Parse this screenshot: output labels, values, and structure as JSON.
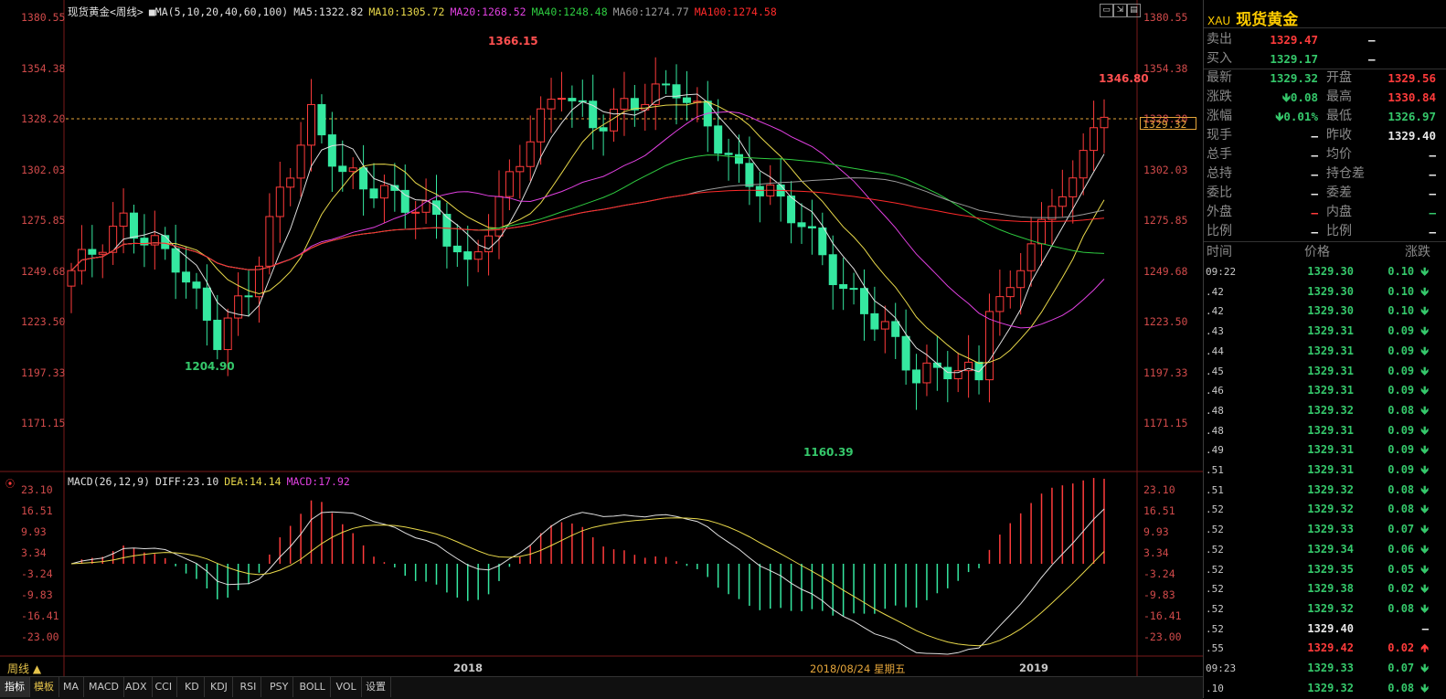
{
  "chart_title": "现货黄金<周线>",
  "ma_legend": {
    "params": "MA(5,10,20,40,60,100)",
    "ma5": "MA5:1322.82",
    "ma10": "MA10:1305.72",
    "ma20": "MA20:1268.52",
    "ma40": "MA40:1248.48",
    "ma60": "MA60:1274.77",
    "ma100": "MA100:1274.58"
  },
  "macd_legend": {
    "params": "MACD(26,12,9)",
    "diff": "DIFF:23.10",
    "dea": "DEA:14.14",
    "macd": "MACD:17.92"
  },
  "colors": {
    "up": "#ff3b3b",
    "down": "#35e8a0",
    "ma5": "#e0e0e0",
    "ma10": "#e8d84a",
    "ma20": "#e040e0",
    "ma40": "#2ecc40",
    "ma60": "#9a9a9a",
    "ma100": "#ff2a2a",
    "price_line": "#e4a53a"
  },
  "price_axis_left": [
    "1380.55",
    "1354.38",
    "1328.20",
    "1302.03",
    "1275.85",
    "1249.68",
    "1223.50",
    "1197.33",
    "1171.15"
  ],
  "price_axis_right": [
    "1380.55",
    "1354.38",
    "1328.20",
    "1302.03",
    "1275.85",
    "1249.68",
    "1223.50",
    "1197.33",
    "1171.15"
  ],
  "macd_axis": [
    "23.10",
    "16.51",
    "9.93",
    "3.34",
    "-3.24",
    "-9.83",
    "-16.41",
    "-23.00"
  ],
  "annotations": {
    "high": "1366.15",
    "low1": "1204.90",
    "low2": "1160.39",
    "recent_high": "1346.80"
  },
  "current_price_tag": "1329.32",
  "time_axis": {
    "t1": "2018",
    "t2": "2018/08/24 星期五",
    "t3": "2019"
  },
  "period_button": "周线",
  "bottom_tabs": [
    "指标",
    "模板",
    "MA",
    "MACD",
    "ADX",
    "CCI",
    "KD",
    "KDJ",
    "RSI",
    "PSY",
    "BOLL",
    "VOL",
    "设置"
  ],
  "quote": {
    "symbol": "XAU",
    "name": "现货黄金",
    "sell_label": "卖出",
    "sell": "1329.47",
    "sell_vol": "—",
    "buy_label": "买入",
    "buy": "1329.17",
    "buy_vol": "—",
    "last_label": "最新",
    "last": "1329.32",
    "open_label": "开盘",
    "open": "1329.56",
    "chg_label": "涨跌",
    "chg": "0.08",
    "high_label": "最高",
    "high": "1330.84",
    "pct_label": "涨幅",
    "pct": "0.01%",
    "low_label": "最低",
    "low": "1326.97",
    "cur_label": "现手",
    "cur": "—",
    "prev_label": "昨收",
    "prev": "1329.40",
    "tot_label": "总手",
    "tot": "—",
    "avg_label": "均价",
    "avg": "—",
    "hold_label": "总持",
    "hold": "—",
    "holddiff_label": "持仓差",
    "holddiff": "—",
    "ratio_label": "委比",
    "ratio": "—",
    "diff_label": "委差",
    "diff": "—",
    "out_label": "外盘",
    "out": "—",
    "in_label": "内盘",
    "in": "—",
    "ratio2_label": "比例",
    "ratio2": "—",
    "ratio3_label": "比例",
    "ratio3": "—"
  },
  "ticks_header": {
    "time": "时间",
    "price": "价格",
    "change": "涨跌"
  },
  "ticks": [
    {
      "time": "09:22",
      "price": "1329.30",
      "chg": "0.10",
      "dir": "down"
    },
    {
      "time": ".42",
      "price": "1329.30",
      "chg": "0.10",
      "dir": "down"
    },
    {
      "time": ".42",
      "price": "1329.30",
      "chg": "0.10",
      "dir": "down"
    },
    {
      "time": ".43",
      "price": "1329.31",
      "chg": "0.09",
      "dir": "down"
    },
    {
      "time": ".44",
      "price": "1329.31",
      "chg": "0.09",
      "dir": "down"
    },
    {
      "time": ".45",
      "price": "1329.31",
      "chg": "0.09",
      "dir": "down"
    },
    {
      "time": ".46",
      "price": "1329.31",
      "chg": "0.09",
      "dir": "down"
    },
    {
      "time": ".48",
      "price": "1329.32",
      "chg": "0.08",
      "dir": "down"
    },
    {
      "time": ".48",
      "price": "1329.31",
      "chg": "0.09",
      "dir": "down"
    },
    {
      "time": ".49",
      "price": "1329.31",
      "chg": "0.09",
      "dir": "down"
    },
    {
      "time": ".51",
      "price": "1329.31",
      "chg": "0.09",
      "dir": "down"
    },
    {
      "time": ".51",
      "price": "1329.32",
      "chg": "0.08",
      "dir": "down"
    },
    {
      "time": ".52",
      "price": "1329.32",
      "chg": "0.08",
      "dir": "down"
    },
    {
      "time": ".52",
      "price": "1329.33",
      "chg": "0.07",
      "dir": "down"
    },
    {
      "time": ".52",
      "price": "1329.34",
      "chg": "0.06",
      "dir": "down"
    },
    {
      "time": ".52",
      "price": "1329.35",
      "chg": "0.05",
      "dir": "down"
    },
    {
      "time": ".52",
      "price": "1329.38",
      "chg": "0.02",
      "dir": "down"
    },
    {
      "time": ".52",
      "price": "1329.32",
      "chg": "0.08",
      "dir": "down"
    },
    {
      "time": ".52",
      "price": "1329.40",
      "chg": "—",
      "dir": "flat"
    },
    {
      "time": ".55",
      "price": "1329.42",
      "chg": "0.02",
      "dir": "up"
    },
    {
      "time": "09:23",
      "price": "1329.33",
      "chg": "0.07",
      "dir": "down"
    },
    {
      "time": ".10",
      "price": "1329.32",
      "chg": "0.08",
      "dir": "down"
    }
  ]
}
